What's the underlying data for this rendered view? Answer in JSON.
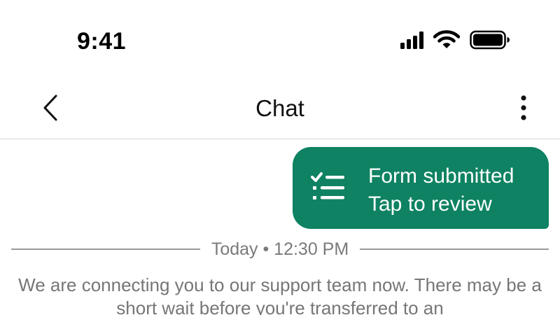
{
  "status_bar": {
    "time": "9:41",
    "icons": [
      "cellular-signal-icon",
      "wifi-icon",
      "battery-icon"
    ]
  },
  "nav": {
    "title": "Chat",
    "back_icon": "chevron-left-icon",
    "more_icon": "more-vertical-icon"
  },
  "form_message": {
    "icon": "checklist-icon",
    "line1": "Form submitted",
    "line2": "Tap to review",
    "bubble_color": "#0e8262"
  },
  "date_separator": {
    "label": "Today • 12:30 PM"
  },
  "system_message": {
    "text": "We are connecting you to our support team now. There may be a short wait before you're transferred to an"
  },
  "colors": {
    "accent": "#0e8262",
    "muted_text": "#767676",
    "divider": "#d6d6d6"
  }
}
